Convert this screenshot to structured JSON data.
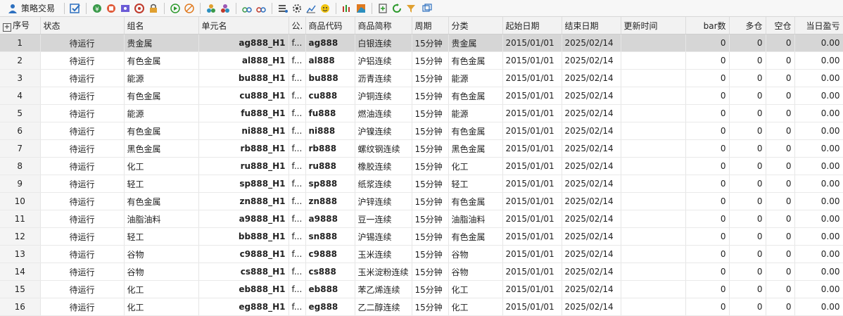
{
  "toolbar": {
    "title": "策略交易",
    "icons": [
      "edit-check-icon",
      "share-icon",
      "ic2-icon",
      "ic3-icon",
      "ic4-icon",
      "lock-icon",
      "play-icon",
      "stop-icon",
      "group-icon",
      "group2-icon",
      "link-icon",
      "link2-icon",
      "list-settings-icon",
      "gear-icon",
      "chart-icon",
      "smiley-icon",
      "candle-icon",
      "color-chart-icon",
      "export-icon",
      "refresh-icon",
      "filter-icon",
      "window-dropdown-icon"
    ]
  },
  "columns": [
    "序号",
    "状态",
    "组名",
    "单元名",
    "公.",
    "商品代码",
    "商品简称",
    "周期",
    "分类",
    "起始日期",
    "结束日期",
    "更新时间",
    "bar数",
    "多仓",
    "空仓",
    "当日盈亏"
  ],
  "rows": [
    {
      "no": "1",
      "status": "待运行",
      "group": "贵金属",
      "unit": "ag888_H1",
      "f": "f...",
      "code": "ag888",
      "name": "白银连续",
      "period": "15分钟",
      "cat": "贵金属",
      "start": "2015/01/01",
      "end": "2025/02/14",
      "upd": "",
      "bars": "0",
      "long": "0",
      "short": "0",
      "pnl": "0.00"
    },
    {
      "no": "2",
      "status": "待运行",
      "group": "有色金属",
      "unit": "al888_H1",
      "f": "f...",
      "code": "al888",
      "name": "沪铝连续",
      "period": "15分钟",
      "cat": "有色金属",
      "start": "2015/01/01",
      "end": "2025/02/14",
      "upd": "",
      "bars": "0",
      "long": "0",
      "short": "0",
      "pnl": "0.00"
    },
    {
      "no": "3",
      "status": "待运行",
      "group": "能源",
      "unit": "bu888_H1",
      "f": "f...",
      "code": "bu888",
      "name": "沥青连续",
      "period": "15分钟",
      "cat": "能源",
      "start": "2015/01/01",
      "end": "2025/02/14",
      "upd": "",
      "bars": "0",
      "long": "0",
      "short": "0",
      "pnl": "0.00"
    },
    {
      "no": "4",
      "status": "待运行",
      "group": "有色金属",
      "unit": "cu888_H1",
      "f": "f...",
      "code": "cu888",
      "name": "沪铜连续",
      "period": "15分钟",
      "cat": "有色金属",
      "start": "2015/01/01",
      "end": "2025/02/14",
      "upd": "",
      "bars": "0",
      "long": "0",
      "short": "0",
      "pnl": "0.00"
    },
    {
      "no": "5",
      "status": "待运行",
      "group": "能源",
      "unit": "fu888_H1",
      "f": "f...",
      "code": "fu888",
      "name": "燃油连续",
      "period": "15分钟",
      "cat": "能源",
      "start": "2015/01/01",
      "end": "2025/02/14",
      "upd": "",
      "bars": "0",
      "long": "0",
      "short": "0",
      "pnl": "0.00"
    },
    {
      "no": "6",
      "status": "待运行",
      "group": "有色金属",
      "unit": "ni888_H1",
      "f": "f...",
      "code": "ni888",
      "name": "沪镍连续",
      "period": "15分钟",
      "cat": "有色金属",
      "start": "2015/01/01",
      "end": "2025/02/14",
      "upd": "",
      "bars": "0",
      "long": "0",
      "short": "0",
      "pnl": "0.00"
    },
    {
      "no": "7",
      "status": "待运行",
      "group": "黑色金属",
      "unit": "rb888_H1",
      "f": "f...",
      "code": "rb888",
      "name": "螺纹钢连续",
      "period": "15分钟",
      "cat": "黑色金属",
      "start": "2015/01/01",
      "end": "2025/02/14",
      "upd": "",
      "bars": "0",
      "long": "0",
      "short": "0",
      "pnl": "0.00"
    },
    {
      "no": "8",
      "status": "待运行",
      "group": "化工",
      "unit": "ru888_H1",
      "f": "f...",
      "code": "ru888",
      "name": "橡胶连续",
      "period": "15分钟",
      "cat": "化工",
      "start": "2015/01/01",
      "end": "2025/02/14",
      "upd": "",
      "bars": "0",
      "long": "0",
      "short": "0",
      "pnl": "0.00"
    },
    {
      "no": "9",
      "status": "待运行",
      "group": "轻工",
      "unit": "sp888_H1",
      "f": "f...",
      "code": "sp888",
      "name": "纸浆连续",
      "period": "15分钟",
      "cat": "轻工",
      "start": "2015/01/01",
      "end": "2025/02/14",
      "upd": "",
      "bars": "0",
      "long": "0",
      "short": "0",
      "pnl": "0.00"
    },
    {
      "no": "10",
      "status": "待运行",
      "group": "有色金属",
      "unit": "zn888_H1",
      "f": "f...",
      "code": "zn888",
      "name": "沪锌连续",
      "period": "15分钟",
      "cat": "有色金属",
      "start": "2015/01/01",
      "end": "2025/02/14",
      "upd": "",
      "bars": "0",
      "long": "0",
      "short": "0",
      "pnl": "0.00"
    },
    {
      "no": "11",
      "status": "待运行",
      "group": "油脂油料",
      "unit": "a9888_H1",
      "f": "f...",
      "code": "a9888",
      "name": "豆一连续",
      "period": "15分钟",
      "cat": "油脂油料",
      "start": "2015/01/01",
      "end": "2025/02/14",
      "upd": "",
      "bars": "0",
      "long": "0",
      "short": "0",
      "pnl": "0.00"
    },
    {
      "no": "12",
      "status": "待运行",
      "group": "轻工",
      "unit": "bb888_H1",
      "f": "f...",
      "code": "sn888",
      "name": "沪锡连续",
      "period": "15分钟",
      "cat": "有色金属",
      "start": "2015/01/01",
      "end": "2025/02/14",
      "upd": "",
      "bars": "0",
      "long": "0",
      "short": "0",
      "pnl": "0.00"
    },
    {
      "no": "13",
      "status": "待运行",
      "group": "谷物",
      "unit": "c9888_H1",
      "f": "f...",
      "code": "c9888",
      "name": "玉米连续",
      "period": "15分钟",
      "cat": "谷物",
      "start": "2015/01/01",
      "end": "2025/02/14",
      "upd": "",
      "bars": "0",
      "long": "0",
      "short": "0",
      "pnl": "0.00"
    },
    {
      "no": "14",
      "status": "待运行",
      "group": "谷物",
      "unit": "cs888_H1",
      "f": "f...",
      "code": "cs888",
      "name": "玉米淀粉连续",
      "period": "15分钟",
      "cat": "谷物",
      "start": "2015/01/01",
      "end": "2025/02/14",
      "upd": "",
      "bars": "0",
      "long": "0",
      "short": "0",
      "pnl": "0.00"
    },
    {
      "no": "15",
      "status": "待运行",
      "group": "化工",
      "unit": "eb888_H1",
      "f": "f...",
      "code": "eb888",
      "name": "苯乙烯连续",
      "period": "15分钟",
      "cat": "化工",
      "start": "2015/01/01",
      "end": "2025/02/14",
      "upd": "",
      "bars": "0",
      "long": "0",
      "short": "0",
      "pnl": "0.00"
    },
    {
      "no": "16",
      "status": "待运行",
      "group": "化工",
      "unit": "eg888_H1",
      "f": "f...",
      "code": "eg888",
      "name": "乙二醇连续",
      "period": "15分钟",
      "cat": "化工",
      "start": "2015/01/01",
      "end": "2025/02/14",
      "upd": "",
      "bars": "0",
      "long": "0",
      "short": "0",
      "pnl": "0.00"
    }
  ]
}
